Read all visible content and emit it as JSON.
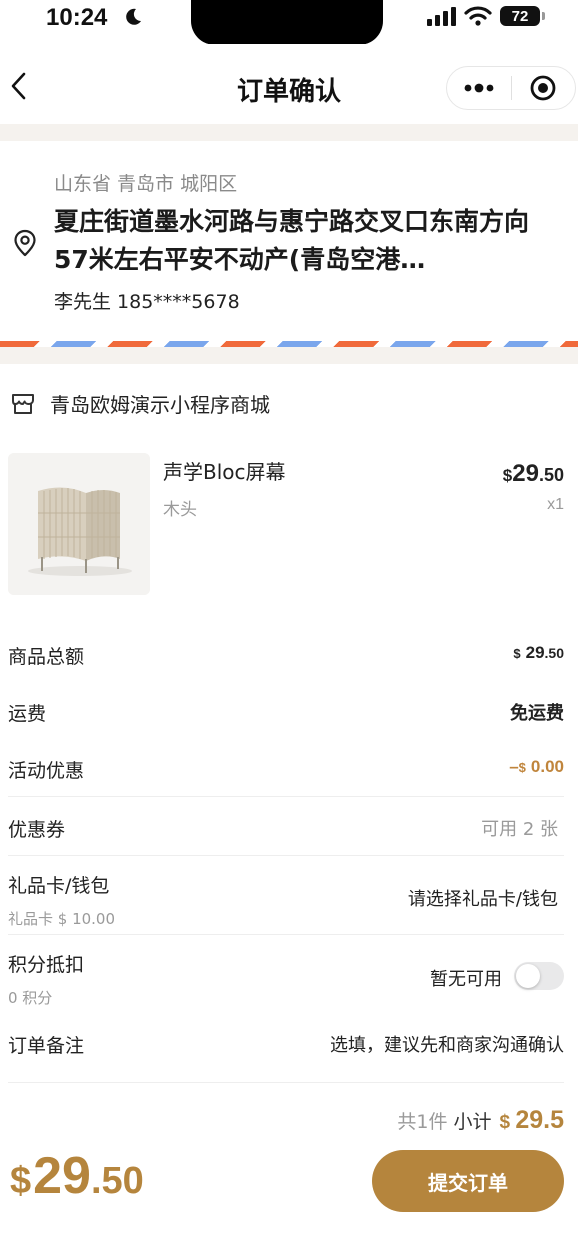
{
  "status_bar": {
    "time": "10:24",
    "battery": "72"
  },
  "nav": {
    "title": "订单确认"
  },
  "address": {
    "region": "山东省 青岛市 城阳区",
    "detail": "夏庄街道墨水河路与惠宁路交叉口东南方向57米左右平安不动产(青岛空港…",
    "contact": "李先生 185****5678"
  },
  "store": {
    "name": "青岛欧姆演示小程序商城"
  },
  "product": {
    "name": "声学Bloc屏幕",
    "spec": "木头",
    "price_currency": "$",
    "price_int": "29",
    "price_dec": ".50",
    "quantity": "x1"
  },
  "rows": {
    "goods_total": {
      "label": "商品总额",
      "currency": "$",
      "value": "29",
      "dec": ".50"
    },
    "shipping": {
      "label": "运费",
      "value": "免运费"
    },
    "promotion": {
      "label": "活动优惠",
      "prefix": "–",
      "currency": "$",
      "value": "0.00"
    },
    "coupon": {
      "label": "优惠券",
      "value": "可用 2 张"
    },
    "gift_card": {
      "label": "礼品卡/钱包",
      "sub": "礼品卡 $ 10.00",
      "value": "请选择礼品卡/钱包"
    },
    "points": {
      "label": "积分抵扣",
      "sub": "0 积分",
      "value": "暂无可用",
      "toggle_on": false
    },
    "remark": {
      "label": "订单备注",
      "placeholder": "选填，建议先和商家沟通确认"
    }
  },
  "summary": {
    "count": "共1件",
    "subtotal_label": "小计",
    "subtotal_currency": "$",
    "subtotal_value": "29.5"
  },
  "footer": {
    "total_currency": "$",
    "total_int": "29",
    "total_dec": ".50",
    "submit_label": "提交订单"
  },
  "colors": {
    "accent": "#b5853d",
    "background": "#f5f2ee",
    "stripe_red": "#f06a3b",
    "stripe_blue": "#7aa6ec"
  }
}
